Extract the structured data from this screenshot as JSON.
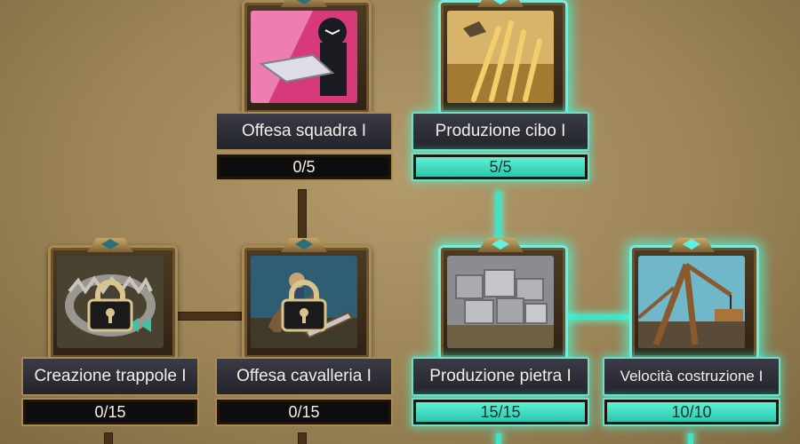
{
  "skills": [
    {
      "id": "offesa-squadra",
      "title": "Offesa squadra I",
      "progress": "0/5",
      "fill": 0,
      "state": "available",
      "icon": "ninja-blade-icon"
    },
    {
      "id": "produzione-cibo",
      "title": "Produzione cibo I",
      "progress": "5/5",
      "fill": 1,
      "state": "done",
      "icon": "wheat-icon"
    },
    {
      "id": "creazione-trappole",
      "title": "Creazione trappole I",
      "progress": "0/15",
      "fill": 0,
      "state": "locked",
      "icon": "trap-icon"
    },
    {
      "id": "offesa-cavalleria",
      "title": "Offesa cavalleria I",
      "progress": "0/15",
      "fill": 0,
      "state": "locked",
      "icon": "cavalry-icon"
    },
    {
      "id": "produzione-pietra",
      "title": "Produzione pietra I",
      "progress": "15/15",
      "fill": 1,
      "state": "done",
      "icon": "stone-icon"
    },
    {
      "id": "velocita-costruzione",
      "title": "Velocità costruzione I",
      "progress": "10/10",
      "fill": 1,
      "state": "done",
      "icon": "crane-icon"
    }
  ],
  "colors": {
    "active": "#3fe3c8",
    "locked_line": "#4a3218",
    "frame": "#a98a52"
  }
}
